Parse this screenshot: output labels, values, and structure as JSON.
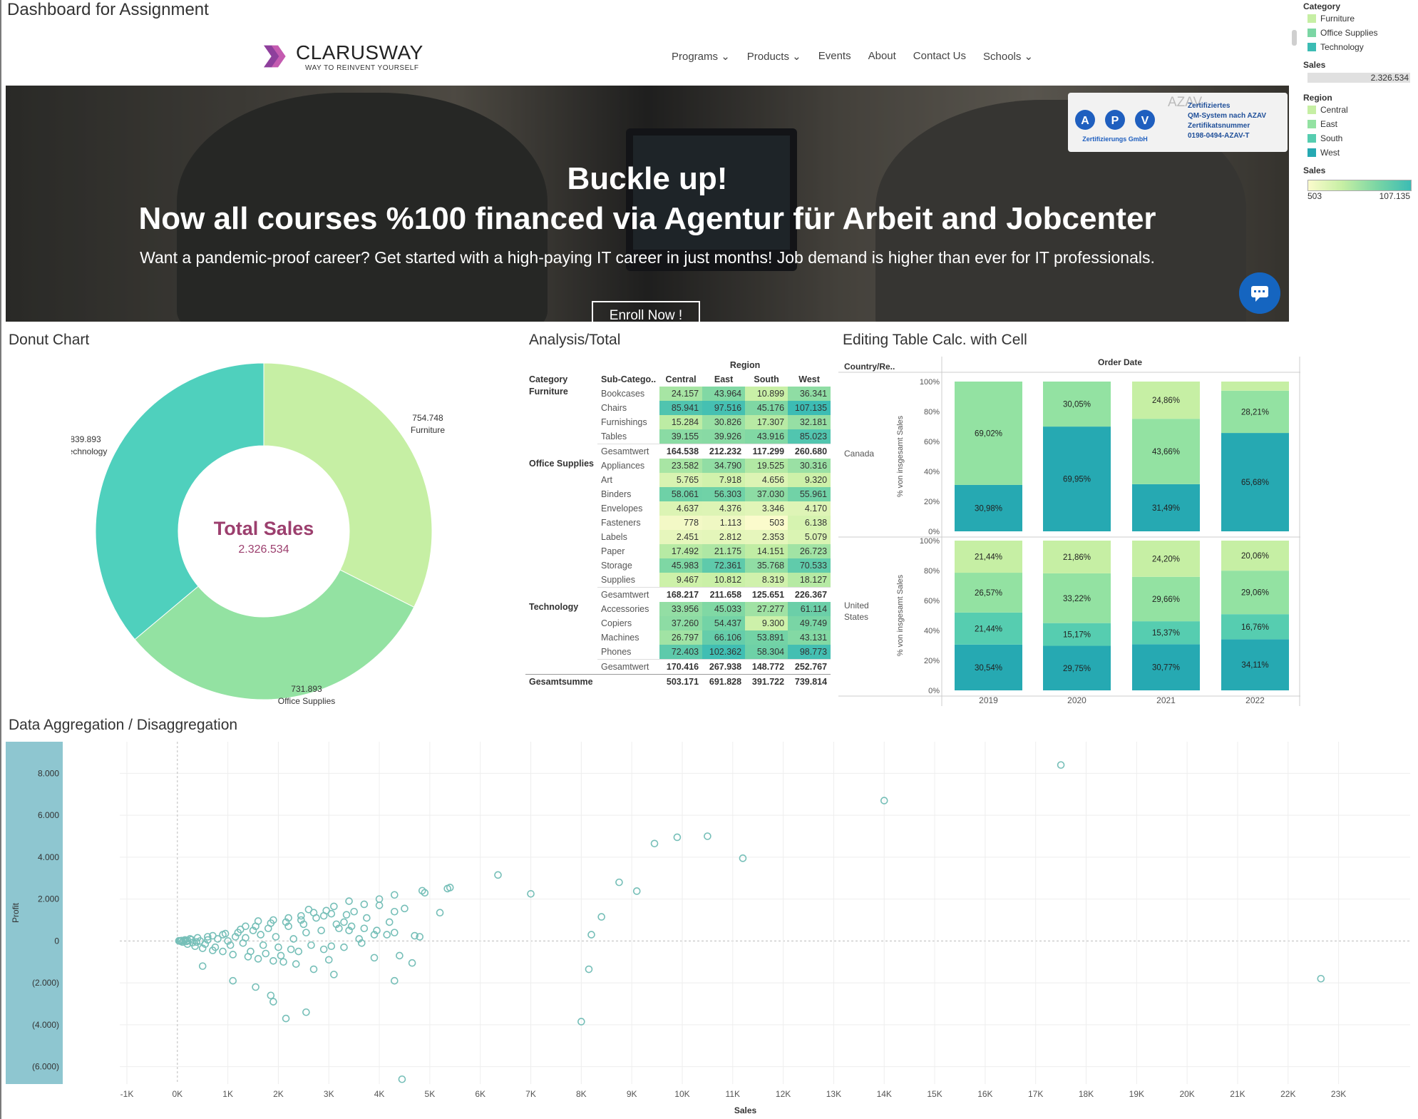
{
  "dashboard": {
    "title": "Dashboard for Assignment"
  },
  "legend": {
    "category_title": "Category",
    "categories": [
      {
        "label": "Furniture",
        "color": "#c6efa4"
      },
      {
        "label": "Office Supplies",
        "color": "#7bd6a4"
      },
      {
        "label": "Technology",
        "color": "#3cbcb4"
      }
    ],
    "sales_title": "Sales",
    "sales_total": "2.326.534",
    "region_title": "Region",
    "regions": [
      {
        "label": "Central",
        "color": "#c6efa4"
      },
      {
        "label": "East",
        "color": "#93e2a2"
      },
      {
        "label": "South",
        "color": "#56cdb0"
      },
      {
        "label": "West",
        "color": "#26a9b2"
      }
    ],
    "sales2_title": "Sales",
    "sales_min": "503",
    "sales_max": "107.135"
  },
  "web": {
    "logo_text": "CLARUSWAY",
    "logo_tagline": "WAY TO REINVENT YOURSELF",
    "nav": [
      "Programs",
      "Products",
      "Events",
      "About",
      "Contact Us",
      "Schools"
    ],
    "hero_line1": "Buckle up!",
    "hero_line2": "Now all courses %100 financed via Agentur für Arbeit and Jobcenter",
    "hero_sub": "Want a pandemic-proof career? Get started with a high-paying IT career in just months! Job demand is higher than ever for IT professionals.",
    "enroll_label": "Enroll Now !",
    "cert_apv": "APV",
    "cert_apv_sub": "Zertifizierungs GmbH",
    "cert_azav": "AZAV",
    "cert_line1": "Zertifiziertes",
    "cert_line2": "QM-System nach AZAV",
    "cert_line3": "Zertifikatsnummer",
    "cert_line4": "0198-0494-AZAV-T"
  },
  "donut": {
    "title": "Donut Chart",
    "center_title": "Total Sales",
    "center_value": "2.326.534"
  },
  "analysis": {
    "title": "Analysis/Total",
    "region_header": "Region",
    "col_category": "Category",
    "col_subcat": "Sub-Catego..",
    "regions": [
      "Central",
      "East",
      "South",
      "West"
    ],
    "groups": [
      {
        "category": "Furniture",
        "rows": [
          {
            "sub": "Bookcases",
            "vals": [
              "24.157",
              "43.964",
              "10.899",
              "36.341"
            ],
            "raw": [
              24157,
              43964,
              10899,
              36341
            ]
          },
          {
            "sub": "Chairs",
            "vals": [
              "85.941",
              "97.516",
              "45.176",
              "107.135"
            ],
            "raw": [
              85941,
              97516,
              45176,
              107135
            ]
          },
          {
            "sub": "Furnishings",
            "vals": [
              "15.284",
              "30.826",
              "17.307",
              "32.181"
            ],
            "raw": [
              15284,
              30826,
              17307,
              32181
            ]
          },
          {
            "sub": "Tables",
            "vals": [
              "39.155",
              "39.926",
              "43.916",
              "85.023"
            ],
            "raw": [
              39155,
              39926,
              43916,
              85023
            ]
          }
        ],
        "total": [
          "164.538",
          "212.232",
          "117.299",
          "260.680"
        ]
      },
      {
        "category": "Office Supplies",
        "rows": [
          {
            "sub": "Appliances",
            "vals": [
              "23.582",
              "34.790",
              "19.525",
              "30.316"
            ],
            "raw": [
              23582,
              34790,
              19525,
              30316
            ]
          },
          {
            "sub": "Art",
            "vals": [
              "5.765",
              "7.918",
              "4.656",
              "9.320"
            ],
            "raw": [
              5765,
              7918,
              4656,
              9320
            ]
          },
          {
            "sub": "Binders",
            "vals": [
              "58.061",
              "56.303",
              "37.030",
              "55.961"
            ],
            "raw": [
              58061,
              56303,
              37030,
              55961
            ]
          },
          {
            "sub": "Envelopes",
            "vals": [
              "4.637",
              "4.376",
              "3.346",
              "4.170"
            ],
            "raw": [
              4637,
              4376,
              3346,
              4170
            ]
          },
          {
            "sub": "Fasteners",
            "vals": [
              "778",
              "1.113",
              "503",
              "6.138"
            ],
            "raw": [
              778,
              1113,
              503,
              6138
            ]
          },
          {
            "sub": "Labels",
            "vals": [
              "2.451",
              "2.812",
              "2.353",
              "5.079"
            ],
            "raw": [
              2451,
              2812,
              2353,
              5079
            ]
          },
          {
            "sub": "Paper",
            "vals": [
              "17.492",
              "21.175",
              "14.151",
              "26.723"
            ],
            "raw": [
              17492,
              21175,
              14151,
              26723
            ]
          },
          {
            "sub": "Storage",
            "vals": [
              "45.983",
              "72.361",
              "35.768",
              "70.533"
            ],
            "raw": [
              45983,
              72361,
              35768,
              70533
            ]
          },
          {
            "sub": "Supplies",
            "vals": [
              "9.467",
              "10.812",
              "8.319",
              "18.127"
            ],
            "raw": [
              9467,
              10812,
              8319,
              18127
            ]
          }
        ],
        "total": [
          "168.217",
          "211.658",
          "125.651",
          "226.367"
        ]
      },
      {
        "category": "Technology",
        "rows": [
          {
            "sub": "Accessories",
            "vals": [
              "33.956",
              "45.033",
              "27.277",
              "61.114"
            ],
            "raw": [
              33956,
              45033,
              27277,
              61114
            ]
          },
          {
            "sub": "Copiers",
            "vals": [
              "37.260",
              "54.437",
              "9.300",
              "49.749"
            ],
            "raw": [
              37260,
              54437,
              9300,
              49749
            ]
          },
          {
            "sub": "Machines",
            "vals": [
              "26.797",
              "66.106",
              "53.891",
              "43.131"
            ],
            "raw": [
              26797,
              66106,
              53891,
              43131
            ]
          },
          {
            "sub": "Phones",
            "vals": [
              "72.403",
              "102.362",
              "58.304",
              "98.773"
            ],
            "raw": [
              72403,
              102362,
              58304,
              98773
            ]
          }
        ],
        "total": [
          "170.416",
          "267.938",
          "148.772",
          "252.767"
        ]
      }
    ],
    "total_label": "Gesamtwert",
    "grand_label": "Gesamtsumme",
    "grand_total": [
      "503.171",
      "691.828",
      "391.722",
      "739.814"
    ]
  },
  "editing": {
    "title": "Editing Table Calc. with Cell",
    "country_header": "Country/Re..",
    "order_header": "Order Date",
    "countries": [
      "Canada",
      "United States"
    ]
  },
  "scatter": {
    "title": "Data Aggregation / Disaggregation"
  },
  "chart_data": [
    {
      "type": "pie",
      "title": "Donut Chart",
      "categories": [
        "Furniture",
        "Office Supplies",
        "Technology"
      ],
      "values": [
        754748,
        731893,
        839893
      ],
      "labels": [
        "754.748",
        "731.893",
        "839.893"
      ],
      "colors": [
        "#c6efa4",
        "#93e2a2",
        "#4fd0bd"
      ]
    },
    {
      "type": "bar",
      "title": "Editing Table Calc. with Cell",
      "stacked": true,
      "ylabel": "% von insgesamt Sales",
      "categories": [
        "2019",
        "2020",
        "2021",
        "2022"
      ],
      "yticks": [
        "0%",
        "20%",
        "40%",
        "60%",
        "80%",
        "100%"
      ],
      "panels": [
        {
          "name": "Canada",
          "series": [
            {
              "name": "Technology",
              "color": "#26a9b2",
              "values": [
                30.98,
                69.95,
                31.49,
                65.68
              ],
              "labels": [
                "30,98%",
                "69,95%",
                "31,49%",
                "65,68%"
              ]
            },
            {
              "name": "Office Supplies",
              "color": "#93e2a2",
              "values": [
                69.02,
                30.05,
                43.66,
                28.21
              ],
              "labels": [
                "69,02%",
                "30,05%",
                "43,66%",
                "28,21%"
              ]
            },
            {
              "name": "Furniture",
              "color": "#c6efa4",
              "values": [
                0,
                0,
                24.86,
                6.11
              ],
              "labels": [
                "",
                "",
                "24,86%",
                ""
              ]
            }
          ]
        },
        {
          "name": "United States",
          "series": [
            {
              "name": "West",
              "color": "#26a9b2",
              "values": [
                30.54,
                29.75,
                30.77,
                34.11
              ],
              "labels": [
                "30,54%",
                "29,75%",
                "30,77%",
                "34,11%"
              ]
            },
            {
              "name": "South",
              "color": "#56cdb0",
              "values": [
                21.44,
                15.17,
                15.37,
                16.76
              ],
              "labels": [
                "21,44%",
                "15,17%",
                "15,37%",
                "16,76%"
              ]
            },
            {
              "name": "East",
              "color": "#93e2a2",
              "values": [
                26.57,
                33.22,
                29.66,
                29.06
              ],
              "labels": [
                "26,57%",
                "33,22%",
                "29,66%",
                "29,06%"
              ]
            },
            {
              "name": "Central",
              "color": "#c6efa4",
              "values": [
                21.44,
                21.86,
                24.2,
                20.06
              ],
              "labels": [
                "21,44%",
                "21,86%",
                "24,20%",
                "20,06%"
              ]
            }
          ]
        }
      ]
    },
    {
      "type": "scatter",
      "title": "Data Aggregation / Disaggregation",
      "xlabel": "Sales",
      "ylabel": "Profit",
      "xlim": [
        -1000,
        23500
      ],
      "ylim": [
        -7000,
        9000
      ],
      "xticks": [
        "-1K",
        "0K",
        "1K",
        "2K",
        "3K",
        "4K",
        "5K",
        "6K",
        "7K",
        "8K",
        "9K",
        "10K",
        "11K",
        "12K",
        "13K",
        "14K",
        "15K",
        "16K",
        "17K",
        "18K",
        "19K",
        "20K",
        "21K",
        "22K",
        "23K"
      ],
      "yticks": [
        {
          "v": 8000,
          "t": "8.000"
        },
        {
          "v": 6000,
          "t": "6.000"
        },
        {
          "v": 4000,
          "t": "4.000"
        },
        {
          "v": 2000,
          "t": "2.000"
        },
        {
          "v": 0,
          "t": "0"
        },
        {
          "v": -2000,
          "t": "(2.000)"
        },
        {
          "v": -4000,
          "t": "(4.000)"
        },
        {
          "v": -6000,
          "t": "(6.000)"
        }
      ],
      "points": [
        [
          17500,
          8400
        ],
        [
          14000,
          6700
        ],
        [
          10500,
          5000
        ],
        [
          9900,
          4950
        ],
        [
          9450,
          4650
        ],
        [
          11200,
          3950
        ],
        [
          6350,
          3150
        ],
        [
          8750,
          2800
        ],
        [
          9100,
          2380
        ],
        [
          7000,
          2250
        ],
        [
          5400,
          2550
        ],
        [
          5350,
          2500
        ],
        [
          4900,
          2300
        ],
        [
          4300,
          2200
        ],
        [
          4850,
          2400
        ],
        [
          4000,
          2000
        ],
        [
          4000,
          1700
        ],
        [
          4500,
          1550
        ],
        [
          4300,
          1400
        ],
        [
          5200,
          1350
        ],
        [
          8400,
          1150
        ],
        [
          8200,
          300
        ],
        [
          8150,
          -1350
        ],
        [
          8000,
          -3850
        ],
        [
          22650,
          -1800
        ],
        [
          4450,
          -6600
        ],
        [
          2550,
          -3400
        ],
        [
          2150,
          -3700
        ],
        [
          1900,
          -2900
        ],
        [
          1850,
          -2600
        ],
        [
          1550,
          -2200
        ],
        [
          1100,
          -1900
        ],
        [
          500,
          -1200
        ],
        [
          3100,
          -1600
        ],
        [
          4300,
          -1900
        ],
        [
          4650,
          -1050
        ],
        [
          4400,
          -700
        ],
        [
          3900,
          -800
        ],
        [
          3050,
          -250
        ],
        [
          4700,
          250
        ],
        [
          4800,
          200
        ],
        [
          4300,
          400
        ],
        [
          3600,
          100
        ],
        [
          3400,
          500
        ],
        [
          3300,
          900
        ],
        [
          2900,
          1200
        ],
        [
          2600,
          1500
        ],
        [
          3500,
          1400
        ],
        [
          3200,
          600
        ],
        [
          2500,
          800
        ],
        [
          2200,
          700
        ],
        [
          1800,
          600
        ],
        [
          1500,
          500
        ],
        [
          1200,
          400
        ],
        [
          900,
          300
        ],
        [
          600,
          200
        ],
        [
          400,
          150
        ],
        [
          250,
          100
        ],
        [
          150,
          50
        ],
        [
          80,
          20
        ],
        [
          50,
          0
        ],
        [
          100,
          -50
        ],
        [
          200,
          -150
        ],
        [
          350,
          -250
        ],
        [
          500,
          -350
        ],
        [
          700,
          -450
        ],
        [
          900,
          -500
        ],
        [
          1100,
          -650
        ],
        [
          1400,
          -750
        ],
        [
          1600,
          -850
        ],
        [
          1900,
          -950
        ],
        [
          2100,
          -1000
        ],
        [
          2350,
          -1100
        ],
        [
          2700,
          -1350
        ],
        [
          3000,
          -900
        ],
        [
          2400,
          -500
        ],
        [
          2000,
          -300
        ],
        [
          1700,
          -200
        ],
        [
          1300,
          -100
        ],
        [
          1000,
          0
        ],
        [
          800,
          100
        ],
        [
          600,
          50
        ],
        [
          450,
          0
        ],
        [
          300,
          -80
        ],
        [
          200,
          30
        ],
        [
          700,
          250
        ],
        [
          950,
          350
        ],
        [
          1250,
          550
        ],
        [
          1550,
          700
        ],
        [
          1850,
          850
        ],
        [
          2150,
          900
        ],
        [
          2450,
          1000
        ],
        [
          2750,
          1100
        ],
        [
          3050,
          1300
        ],
        [
          3350,
          1250
        ],
        [
          3750,
          1100
        ],
        [
          4200,
          900
        ],
        [
          3900,
          300
        ],
        [
          3650,
          -100
        ],
        [
          3300,
          -300
        ],
        [
          2900,
          -400
        ],
        [
          2650,
          -200
        ],
        [
          2300,
          100
        ],
        [
          1950,
          200
        ],
        [
          1650,
          300
        ],
        [
          1350,
          150
        ],
        [
          1050,
          -200
        ],
        [
          750,
          -300
        ],
        [
          550,
          -150
        ],
        [
          380,
          -50
        ],
        [
          280,
          60
        ],
        [
          180,
          -20
        ],
        [
          120,
          10
        ],
        [
          60,
          -10
        ],
        [
          30,
          5
        ],
        [
          1450,
          -500
        ],
        [
          1750,
          -600
        ],
        [
          2050,
          -700
        ],
        [
          2250,
          -400
        ],
        [
          2550,
          400
        ],
        [
          2850,
          500
        ],
        [
          3150,
          800
        ],
        [
          3450,
          700
        ],
        [
          3700,
          600
        ],
        [
          3950,
          500
        ],
        [
          4150,
          300
        ],
        [
          1150,
          200
        ],
        [
          1350,
          700
        ],
        [
          1600,
          950
        ],
        [
          1900,
          1000
        ],
        [
          2200,
          1100
        ],
        [
          2450,
          1200
        ],
        [
          2700,
          1350
        ],
        [
          2950,
          1450
        ],
        [
          3100,
          1650
        ],
        [
          3400,
          1900
        ],
        [
          3700,
          1750
        ]
      ]
    }
  ]
}
